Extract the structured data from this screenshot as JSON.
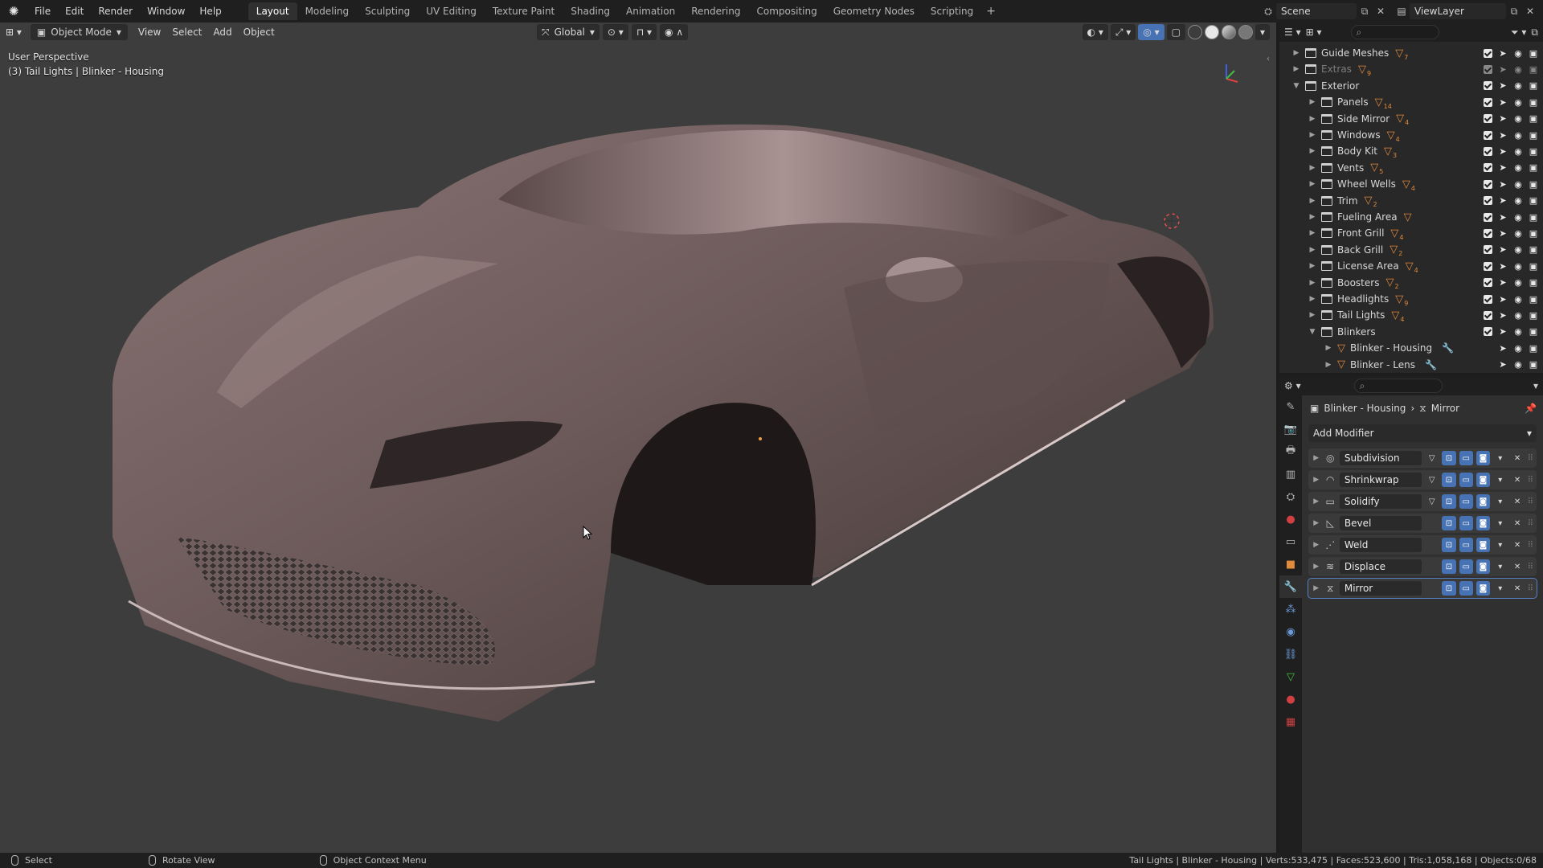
{
  "topbar": {
    "menus": [
      "File",
      "Edit",
      "Render",
      "Window",
      "Help"
    ],
    "workspaces": [
      "Layout",
      "Modeling",
      "Sculpting",
      "UV Editing",
      "Texture Paint",
      "Shading",
      "Animation",
      "Rendering",
      "Compositing",
      "Geometry Nodes",
      "Scripting"
    ],
    "active_workspace": "Layout",
    "add_tab": "+",
    "scene": "Scene",
    "view_layer": "ViewLayer"
  },
  "viewport": {
    "mode": "Object Mode",
    "menus": [
      "View",
      "Select",
      "Add",
      "Object"
    ],
    "transform_orientation": "Global",
    "perspective_label": "User Perspective",
    "object_label": "(3) Tail Lights | Blinker - Housing"
  },
  "outliner": {
    "rows": [
      {
        "name": "Guide Meshes",
        "count": "7",
        "dim": false,
        "expanded": false,
        "level": 0
      },
      {
        "name": "Extras",
        "count": "9",
        "dim": true,
        "expanded": false,
        "level": 0
      },
      {
        "name": "Exterior",
        "count": "",
        "dim": false,
        "expanded": true,
        "level": 0
      },
      {
        "name": "Panels",
        "count": "14",
        "dim": false,
        "expanded": false,
        "level": 1
      },
      {
        "name": "Side Mirror",
        "count": "4",
        "dim": false,
        "expanded": false,
        "level": 1
      },
      {
        "name": "Windows",
        "count": "4",
        "dim": false,
        "expanded": false,
        "level": 1
      },
      {
        "name": "Body Kit",
        "count": "3",
        "dim": false,
        "expanded": false,
        "level": 1
      },
      {
        "name": "Vents",
        "count": "5",
        "dim": false,
        "expanded": false,
        "level": 1
      },
      {
        "name": "Wheel Wells",
        "count": "4",
        "dim": false,
        "expanded": false,
        "level": 1
      },
      {
        "name": "Trim",
        "count": "2",
        "dim": false,
        "expanded": false,
        "level": 1
      },
      {
        "name": "Fueling Area",
        "count": "",
        "dim": false,
        "expanded": false,
        "level": 1
      },
      {
        "name": "Front Grill",
        "count": "4",
        "dim": false,
        "expanded": false,
        "level": 1
      },
      {
        "name": "Back Grill",
        "count": "2",
        "dim": false,
        "expanded": false,
        "level": 1
      },
      {
        "name": "License Area",
        "count": "4",
        "dim": false,
        "expanded": false,
        "level": 1
      },
      {
        "name": "Boosters",
        "count": "2",
        "dim": false,
        "expanded": false,
        "level": 1
      },
      {
        "name": "Headlights",
        "count": "9",
        "dim": false,
        "expanded": false,
        "level": 1
      },
      {
        "name": "Tail Lights",
        "count": "4",
        "dim": false,
        "expanded": false,
        "level": 1
      },
      {
        "name": "Blinkers",
        "count": "",
        "dim": false,
        "expanded": true,
        "level": 1
      },
      {
        "name": "Blinker - Housing",
        "count": "",
        "dim": false,
        "expanded": false,
        "level": 2,
        "object": true
      },
      {
        "name": "Blinker - Lens",
        "count": "",
        "dim": false,
        "expanded": false,
        "level": 2,
        "object": true
      }
    ]
  },
  "properties": {
    "breadcrumb_object": "Blinker - Housing",
    "breadcrumb_modifier": "Mirror",
    "add_modifier": "Add Modifier",
    "modifiers": [
      {
        "name": "Subdivision",
        "icon": "subdivision-icon",
        "glyph": "◎",
        "editmode": true
      },
      {
        "name": "Shrinkwrap",
        "icon": "shrinkwrap-icon",
        "glyph": "◠",
        "editmode": true
      },
      {
        "name": "Solidify",
        "icon": "solidify-icon",
        "glyph": "▭",
        "editmode": true
      },
      {
        "name": "Bevel",
        "icon": "bevel-icon",
        "glyph": "◺",
        "editmode": false
      },
      {
        "name": "Weld",
        "icon": "weld-icon",
        "glyph": "⋰",
        "editmode": false
      },
      {
        "name": "Displace",
        "icon": "displace-icon",
        "glyph": "≋",
        "editmode": false
      },
      {
        "name": "Mirror",
        "icon": "mirror-icon",
        "glyph": "⧖",
        "editmode": false
      }
    ],
    "active_modifier": "Mirror"
  },
  "statusbar": {
    "left": "Select",
    "middle": "Rotate View",
    "right": "Object Context Menu",
    "stats": "Tail Lights | Blinker - Housing | Verts:533,475 | Faces:523,600 | Tris:1,058,168 | Objects:0/68"
  },
  "colors": {
    "accent": "#4772b3",
    "mesh_orange": "#e08a3c",
    "viewport_bg": "#3d3d3d",
    "car_body": "#6b5a5a"
  }
}
